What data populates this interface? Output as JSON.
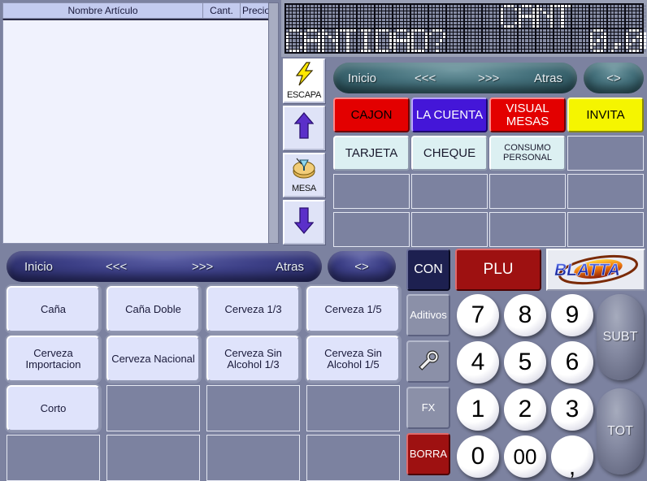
{
  "receipt": {
    "columns": [
      "Nombre Artículo",
      "Cant.",
      "Precio"
    ],
    "rows": []
  },
  "led_display": {
    "line1": "            CANT",
    "line2": "CANTIDAD?        0,00"
  },
  "icon_column": [
    {
      "name": "escape",
      "label": "ESCAPA",
      "icon": "lightning-bolt-icon"
    },
    {
      "name": "scroll-up",
      "label": "",
      "icon": "arrow-up-icon"
    },
    {
      "name": "table",
      "label": "MESA",
      "icon": "table-icon"
    },
    {
      "name": "scroll-down",
      "label": "",
      "icon": "arrow-down-icon"
    }
  ],
  "nav_top": {
    "items": [
      "Inicio",
      "<<<",
      ">>>",
      "Atras"
    ],
    "toggle": "<>"
  },
  "nav_bottom": {
    "items": [
      "Inicio",
      "<<<",
      ">>>",
      "Atras"
    ],
    "toggle": "<>"
  },
  "function_keys": [
    {
      "label": "CAJON",
      "style": "key-red"
    },
    {
      "label": "LA CUENTA",
      "style": "key-blue"
    },
    {
      "label": "VISUAL MESAS",
      "style": "key-red-w"
    },
    {
      "label": "INVITA",
      "style": "key-yellow"
    },
    {
      "label": "TARJETA",
      "style": "key-cyan"
    },
    {
      "label": "CHEQUE",
      "style": "key-cyan"
    },
    {
      "label": "CONSUMO PERSONAL",
      "style": "key-cyan"
    },
    {
      "label": "",
      "style": "key-empty"
    },
    {
      "label": "",
      "style": "key-empty"
    },
    {
      "label": "",
      "style": "key-empty"
    },
    {
      "label": "",
      "style": "key-empty"
    },
    {
      "label": "",
      "style": "key-empty"
    },
    {
      "label": "",
      "style": "key-empty"
    },
    {
      "label": "",
      "style": "key-empty"
    },
    {
      "label": "",
      "style": "key-empty"
    },
    {
      "label": "",
      "style": "key-empty"
    }
  ],
  "products": [
    {
      "label": "Caña",
      "filled": true
    },
    {
      "label": "Caña Doble",
      "filled": true
    },
    {
      "label": "Cerveza 1/3",
      "filled": true
    },
    {
      "label": "Cerveza 1/5",
      "filled": true
    },
    {
      "label": "Cerveza Importacion",
      "filled": true
    },
    {
      "label": "Cerveza Nacional",
      "filled": true
    },
    {
      "label": "Cerveza Sin Alcohol 1/3",
      "filled": true
    },
    {
      "label": "Cerveza Sin Alcohol 1/5",
      "filled": true
    },
    {
      "label": "Corto",
      "filled": true
    },
    {
      "label": "",
      "filled": false
    },
    {
      "label": "",
      "filled": false
    },
    {
      "label": "",
      "filled": false
    },
    {
      "label": "",
      "filled": false
    },
    {
      "label": "",
      "filled": false
    },
    {
      "label": "",
      "filled": false
    },
    {
      "label": "",
      "filled": false
    }
  ],
  "mode_keys": {
    "con": "CON",
    "plu": "PLU"
  },
  "logo": {
    "text": "BLATTA"
  },
  "side_keys": [
    {
      "label": "Aditivos",
      "style": "key-gray",
      "icon": ""
    },
    {
      "label": "",
      "style": "key-gray",
      "icon": "wrench-icon"
    },
    {
      "label": "FX",
      "style": "key-gray",
      "icon": ""
    },
    {
      "label": "BORRA",
      "style": "key-darkred",
      "icon": ""
    }
  ],
  "keypad": [
    "7",
    "8",
    "9",
    "4",
    "5",
    "6",
    "1",
    "2",
    "3",
    "0",
    "00",
    ","
  ],
  "totals": {
    "subtotal": "SUBT",
    "total": "TOT"
  },
  "colors": {
    "background": "#7c82a0",
    "receipt_bg": "#f0f2fd",
    "header_bg": "#c3cbef",
    "accent_red": "#e30000",
    "accent_blue": "#4416d8",
    "accent_yellow": "#f5f500",
    "accent_cyan": "#dcf0f2",
    "product_key": "#dfe3fb",
    "nav_teal": "#45717c",
    "nav_blue": "#3c3f86"
  }
}
